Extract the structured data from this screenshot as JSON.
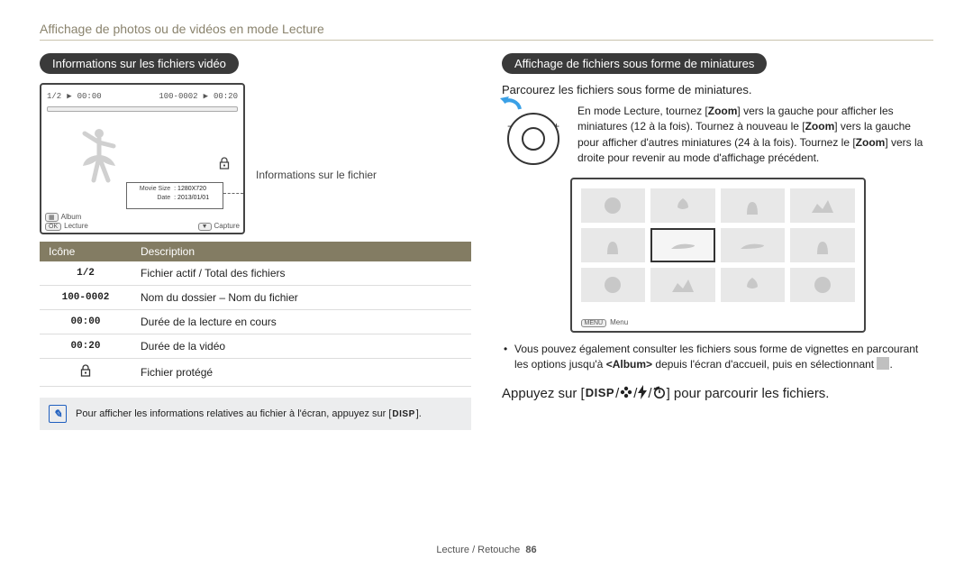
{
  "page_title": "Affichage de photos ou de vidéos en mode Lecture",
  "footer": {
    "section": "Lecture / Retouche",
    "page": "86"
  },
  "left": {
    "heading": "Informations sur les fichiers vidéo",
    "callout": "Informations sur le fichier",
    "screen": {
      "counter": "1/2",
      "time_elapsed": "00:00",
      "folder_file": "100-0002",
      "play_icon": "▶",
      "time_total": "00:20",
      "info_movie_size_label": "Movie Size",
      "info_movie_size_value": "1280X720",
      "info_date_label": "Date",
      "info_date_value": "2013/01/01",
      "album_badge": "▦",
      "album_label": "Album",
      "ok_badge": "OK",
      "lecture_label": "Lecture",
      "cap_badge": "▼",
      "capture_label": "Capture"
    },
    "table": {
      "head_icon": "Icône",
      "head_desc": "Description",
      "rows": [
        {
          "icon": "1/2",
          "desc": "Fichier actif / Total des fichiers"
        },
        {
          "icon": "100-0002",
          "desc": "Nom du dossier – Nom du fichier"
        },
        {
          "icon": "00:00",
          "desc": "Durée de la lecture en cours"
        },
        {
          "icon": "00:20",
          "desc": "Durée de la vidéo"
        },
        {
          "icon": "⚿",
          "icon_name": "lock-icon",
          "desc": "Fichier protégé"
        }
      ]
    },
    "note_pre": "Pour afficher les informations relatives au fichier à l'écran, appuyez sur [",
    "note_disp": "DISP",
    "note_post": "]."
  },
  "right": {
    "heading": "Affichage de fichiers sous forme de miniatures",
    "sub": "Parcourez les fichiers sous forme de miniatures.",
    "dial_text_1": "En mode Lecture, tournez [",
    "zoom1": "Zoom",
    "dial_text_2": "] vers la gauche pour afficher les miniatures (12 à la fois). Tournez à nouveau le [",
    "zoom2": "Zoom",
    "dial_text_3": "] vers la gauche pour afficher d'autres miniatures (24 à la fois). Tournez le [",
    "zoom3": "Zoom",
    "dial_text_4": "] vers la droite pour revenir au mode d'affichage précédent.",
    "thumb_menu_badge": "MENU",
    "thumb_menu_label": "Menu",
    "bullet_1a": "Vous pouvez également consulter les fichiers sous forme de vignettes en parcourant les options jusqu'à ",
    "bullet_album": "<Album>",
    "bullet_1b": " depuis l'écran d'accueil, puis en sélectionnant ",
    "bullet_1c": ".",
    "step_pre": "Appuyez sur [",
    "step_disp": "DISP",
    "step_sep1": "/",
    "step_icon2": "flower-icon",
    "step_sep2": "/",
    "step_icon3": "flash-icon",
    "step_sep3": "/",
    "step_icon4": "timer-icon",
    "step_post": "] pour parcourir les fichiers."
  }
}
